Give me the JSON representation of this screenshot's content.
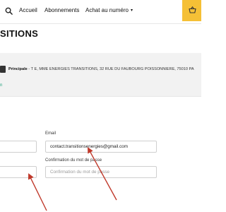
{
  "nav": {
    "home": "Accueil",
    "subscriptions": "Abonnements",
    "buy_issue": "Achat au numéro",
    "buy_caret": "▾"
  },
  "page": {
    "title": "SITIONS"
  },
  "address": {
    "label": "Principale",
    "text": " - T E, MME ENERGIES TRANSITIONS, 32 RUE DU FAUBOURG POISSONNIERE, 75010 PA",
    "link": "n"
  },
  "form": {
    "email_label": "Email",
    "email_value": "contact.transitionsenergies@gmail.com",
    "confirm_label": "Confirmation du mot de passe",
    "confirm_placeholder": "Confirmation du mot de passe",
    "left_field_1_value": "",
    "left_field_2_value": ""
  },
  "colors": {
    "accent": "#f5c036",
    "link": "#1aa07a",
    "annotation_arrow": "#c0392b"
  }
}
